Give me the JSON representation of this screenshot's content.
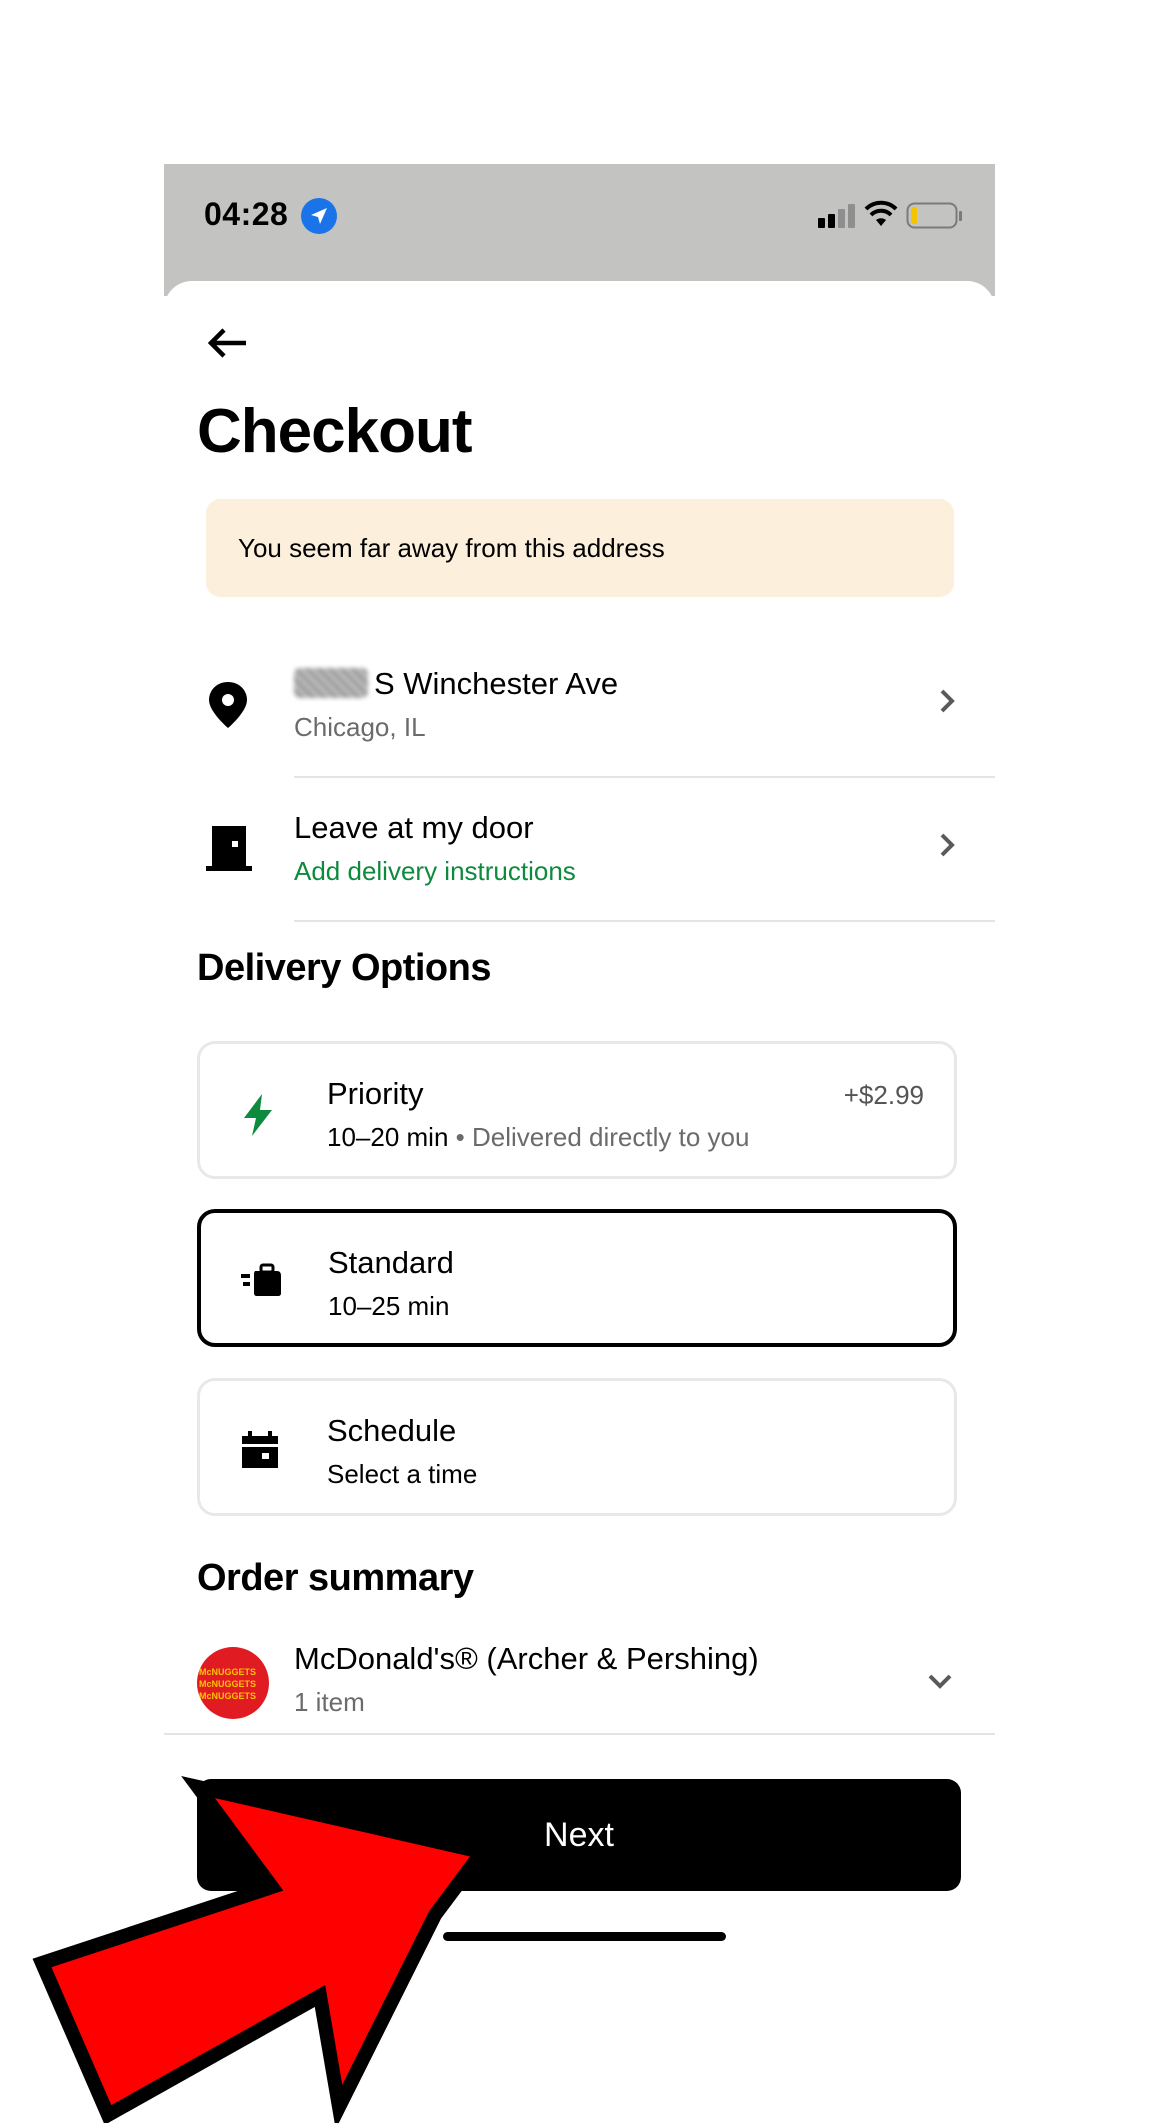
{
  "status_bar": {
    "time": "04:28",
    "location_icon": "location-arrow-icon",
    "signal_icon": "cellular-signal-icon",
    "wifi_icon": "wifi-icon",
    "battery_icon": "battery-low-icon"
  },
  "header": {
    "back_icon": "arrow-left-icon",
    "title": "Checkout"
  },
  "warning_banner": {
    "text": "You seem far away from this address",
    "background": "#fcf0dc"
  },
  "address": {
    "icon": "map-pin-icon",
    "street": "S Winchester Ave",
    "city": "Chicago, IL",
    "chevron_icon": "chevron-right-icon"
  },
  "dropoff": {
    "icon": "door-icon",
    "title": "Leave at my door",
    "link": "Add delivery instructions",
    "link_color": "#0e8a3e",
    "chevron_icon": "chevron-right-icon"
  },
  "delivery_options": {
    "heading": "Delivery Options",
    "options": [
      {
        "icon": "lightning-bolt-icon",
        "title": "Priority",
        "time": "10–20 min",
        "detail": " • Delivered directly to you",
        "price": "+$2.99",
        "selected": false
      },
      {
        "icon": "courier-bag-icon",
        "title": "Standard",
        "time": "10–25 min",
        "detail": "",
        "price": "",
        "selected": true
      },
      {
        "icon": "calendar-icon",
        "title": "Schedule",
        "time": "Select a time",
        "detail": "",
        "price": "",
        "selected": false
      }
    ]
  },
  "order_summary": {
    "heading": "Order summary",
    "store": "McDonald's® (Archer & Pershing)",
    "items": "1 item",
    "logo_icon": "store-logo-icon",
    "chevron_icon": "chevron-down-icon"
  },
  "footer": {
    "next_label": "Next"
  },
  "colors": {
    "accent_green": "#0e8a3e",
    "status_bar_bg": "#c3c4c2",
    "annotation_arrow": "#ff0000"
  }
}
